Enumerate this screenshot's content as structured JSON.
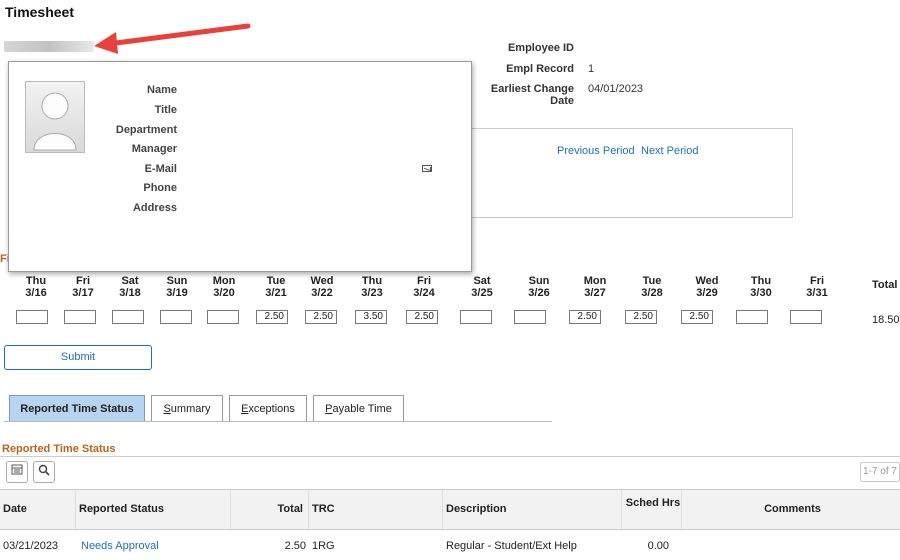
{
  "page": {
    "title": "Timesheet"
  },
  "employee_info": {
    "employee_id_label": "Employee ID",
    "empl_record_label": "Empl Record",
    "empl_record_value": "1",
    "earliest_change_label": "Earliest Change Date",
    "earliest_change_value": "04/01/2023"
  },
  "period_nav": {
    "previous": "Previous Period",
    "next": "Next Period"
  },
  "popup": {
    "labels": [
      "Name",
      "Title",
      "Department",
      "Manager",
      "E-Mail",
      "Phone",
      "Address"
    ]
  },
  "partial_heading": "Fi",
  "days": [
    {
      "dow": "Thu",
      "date": "3/16",
      "value": ""
    },
    {
      "dow": "Fri",
      "date": "3/17",
      "value": ""
    },
    {
      "dow": "Sat",
      "date": "3/18",
      "value": ""
    },
    {
      "dow": "Sun",
      "date": "3/19",
      "value": ""
    },
    {
      "dow": "Mon",
      "date": "3/20",
      "value": ""
    },
    {
      "dow": "Tue",
      "date": "3/21",
      "value": "2.50"
    },
    {
      "dow": "Wed",
      "date": "3/22",
      "value": "2.50"
    },
    {
      "dow": "Thu",
      "date": "3/23",
      "value": "3.50"
    },
    {
      "dow": "Fri",
      "date": "3/24",
      "value": "2.50"
    },
    {
      "dow": "Sat",
      "date": "3/25",
      "value": ""
    },
    {
      "dow": "Sun",
      "date": "3/26",
      "value": ""
    },
    {
      "dow": "Mon",
      "date": "3/27",
      "value": "2.50"
    },
    {
      "dow": "Tue",
      "date": "3/28",
      "value": "2.50"
    },
    {
      "dow": "Wed",
      "date": "3/29",
      "value": "2.50"
    },
    {
      "dow": "Thu",
      "date": "3/30",
      "value": ""
    },
    {
      "dow": "Fri",
      "date": "3/31",
      "value": ""
    }
  ],
  "total_label": "Total",
  "total_value": "18.50",
  "submit_label": "Submit",
  "tabs": [
    {
      "label": "Reported Time Status",
      "active": true
    },
    {
      "label": "Summary",
      "underline": "S",
      "rest": "ummary"
    },
    {
      "label": "Exceptions",
      "underline": "E",
      "rest": "xceptions"
    },
    {
      "label": "Payable Time",
      "underline": "P",
      "rest": "ayable Time"
    }
  ],
  "section_title": "Reported Time Status",
  "pager_text": "1-7 of 7",
  "table": {
    "headers": [
      "Date",
      "Reported Status",
      "Total",
      "TRC",
      "Description",
      "Sched Hrs",
      "Comments"
    ],
    "rows": [
      {
        "date": "03/21/2023",
        "status": "Needs Approval",
        "total": "2.50",
        "trc": "1RG",
        "description": "Regular - Student/Ext Help",
        "sched": "0.00",
        "comments": ""
      }
    ]
  },
  "colors": {
    "accent_blue": "#1f6fbf",
    "section_orange": "#b5651d",
    "tab_active_bg": "#b8d4f0",
    "arrow_red": "#e8413b"
  }
}
